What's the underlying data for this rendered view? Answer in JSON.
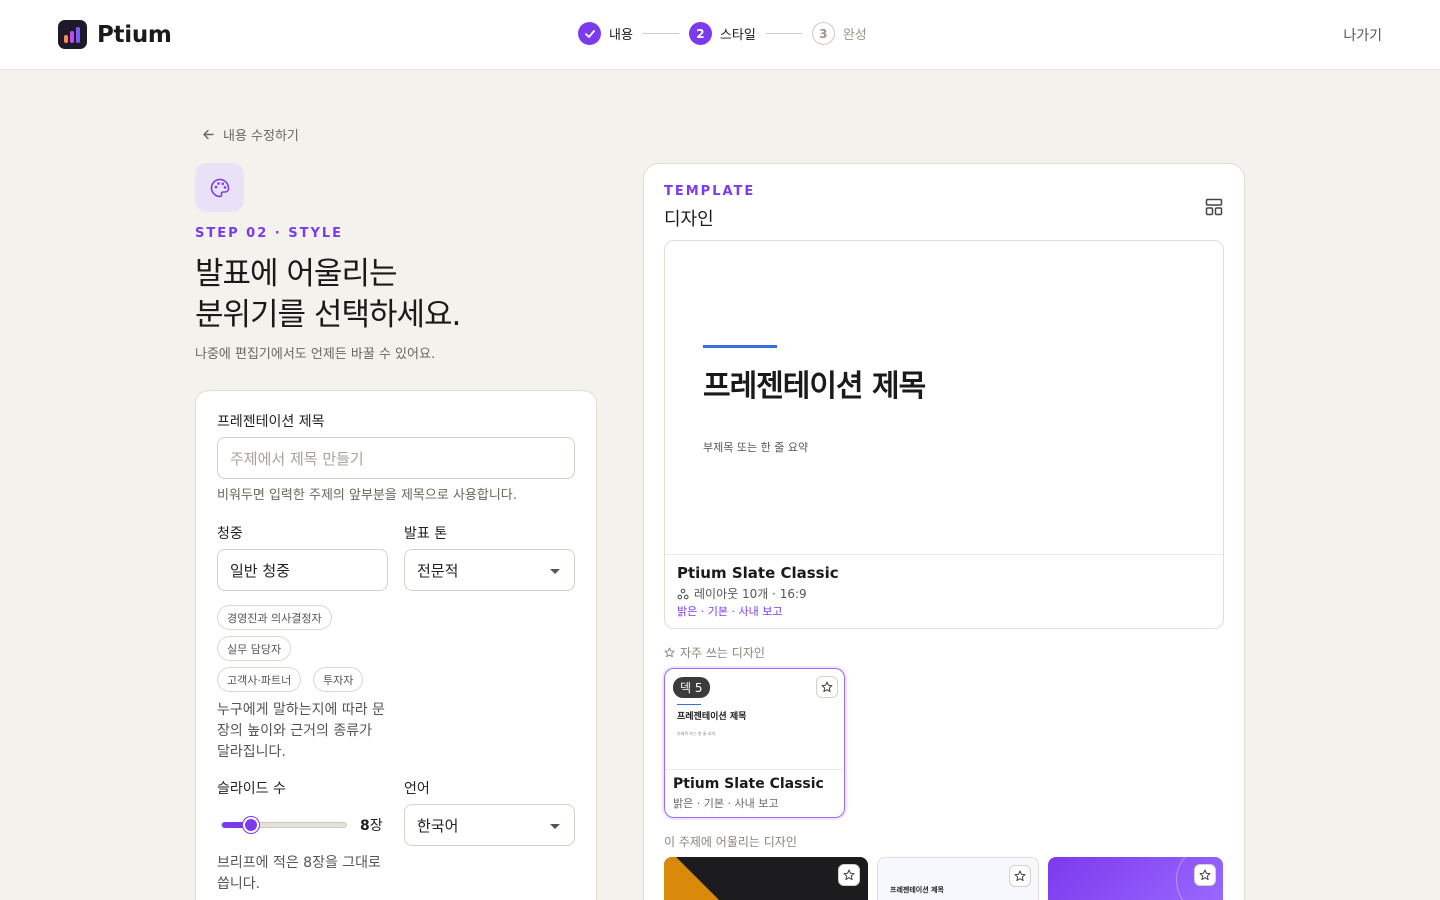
{
  "header": {
    "brand": "Ptium",
    "steps": [
      {
        "label": "내용",
        "state": "done"
      },
      {
        "number": "2",
        "label": "스타일",
        "state": "active"
      },
      {
        "number": "3",
        "label": "완성",
        "state": "todo"
      }
    ],
    "exit_label": "나가기"
  },
  "left": {
    "back_label": "내용 수정하기",
    "eyebrow": "STEP 02 · STYLE",
    "headline_line1": "발표에 어울리는",
    "headline_line2": "분위기를 선택하세요.",
    "subtitle": "나중에 편집기에서도 언제든 바꿀 수 있어요."
  },
  "form": {
    "title_label": "프레젠테이션 제목",
    "title_placeholder": "주제에서 제목 만들기",
    "title_value": "",
    "title_help": "비워두면 입력한 주제의 앞부분을 제목으로 사용합니다.",
    "audience_label": "청중",
    "audience_value": "일반 청중",
    "tone_label": "발표 톤",
    "tone_value": "전문적",
    "audience_chips": [
      "경영진과 의사결정자",
      "실무 담당자",
      "고객사·파트너",
      "투자자"
    ],
    "audience_help": "누구에게 말하는지에 따라 문장의 높이와 근거의 종류가 달라집니다.",
    "slides_label": "슬라이드 수",
    "slides_value": "8",
    "slides_unit": "장",
    "slides_fraction": 0.17,
    "language_label": "언어",
    "language_value": "한국어",
    "slides_help": "브리프에 적은 8장을 그대로 씁니다."
  },
  "panel": {
    "eyebrow": "TEMPLATE",
    "title": "디자인",
    "preview": {
      "slide_title": "프레젠테이션 제목",
      "slide_subtitle": "부제목 또는 한 줄 요약",
      "name": "Ptium Slate Classic",
      "meta": "레이아웃 10개 · 16:9",
      "tags": "밝은 · 기본 · 사내 보고"
    },
    "favorites_label": "자주 쓰는 디자인",
    "favorite": {
      "badge": "덱 5",
      "slide_title": "프레젠테이션 제목",
      "slide_subtitle": "부제목 또는 한 줄 요약",
      "name": "Ptium Slate Classic",
      "tags": "밝은 · 기본 · 사내 보고"
    },
    "suggested_label": "이 주제에 어울리는 디자인",
    "suggested_thumb_title": "프레젠테이션 제목"
  },
  "colors": {
    "accent": "#7c3aed",
    "background": "#f4f2ed",
    "slide_accent": "#3b6fe0"
  }
}
